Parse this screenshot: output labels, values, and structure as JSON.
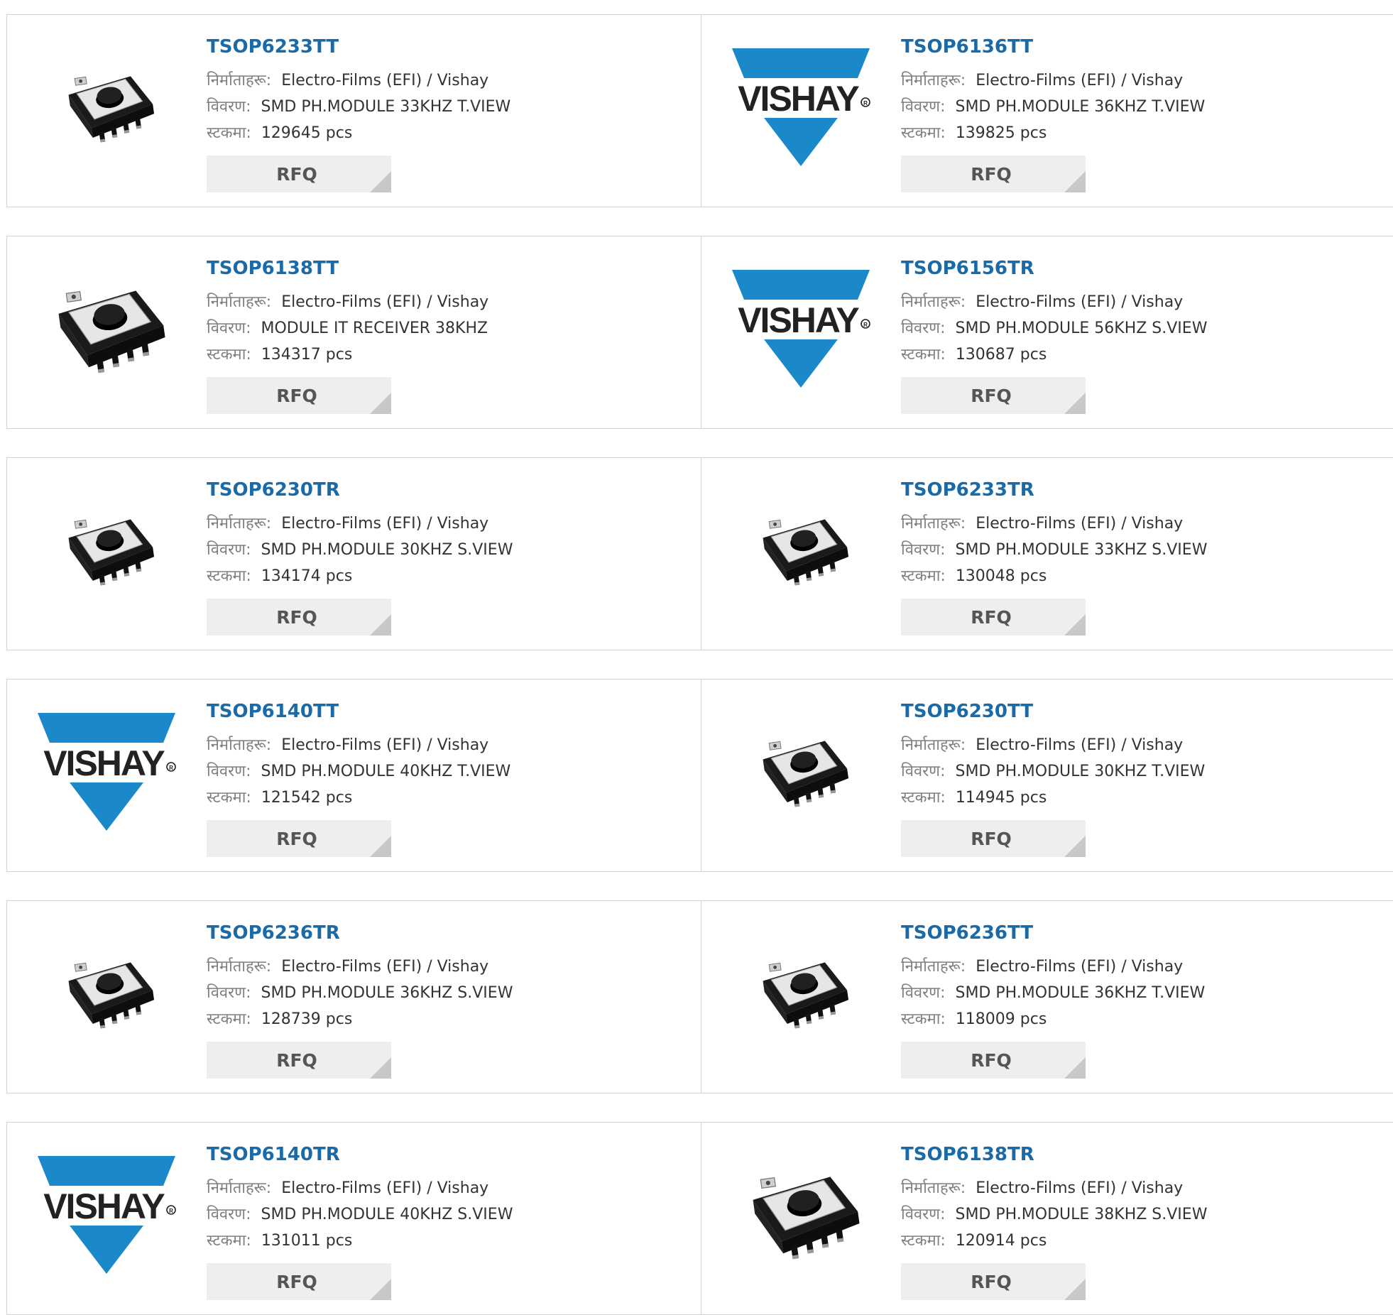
{
  "labels": {
    "manufacturer": "निर्माताहरू:",
    "description": "विवरण:",
    "stock": "स्टकमा:",
    "rfq": "RFQ"
  },
  "logo": {
    "text": "VISHAY",
    "registered": "®",
    "color": "#1b88c9"
  },
  "accent": "#1a6aa8",
  "products": [
    {
      "name": "TSOP6233TT",
      "manufacturer": "Electro-Films (EFI) / Vishay",
      "description": "SMD PH.MODULE 33KHZ T.VIEW",
      "stock": "129645 pcs",
      "image": "switch-small"
    },
    {
      "name": "TSOP6136TT",
      "manufacturer": "Electro-Films (EFI) / Vishay",
      "description": "SMD PH.MODULE 36KHZ T.VIEW",
      "stock": "139825 pcs",
      "image": "vishay-logo"
    },
    {
      "name": "TSOP6138TT",
      "manufacturer": "Electro-Films (EFI) / Vishay",
      "description": "MODULE IT RECEIVER 38KHZ",
      "stock": "134317 pcs",
      "image": "switch-large"
    },
    {
      "name": "TSOP6156TR",
      "manufacturer": "Electro-Films (EFI) / Vishay",
      "description": "SMD PH.MODULE 56KHZ S.VIEW",
      "stock": "130687 pcs",
      "image": "vishay-logo"
    },
    {
      "name": "TSOP6230TR",
      "manufacturer": "Electro-Films (EFI) / Vishay",
      "description": "SMD PH.MODULE 30KHZ S.VIEW",
      "stock": "134174 pcs",
      "image": "switch-small"
    },
    {
      "name": "TSOP6233TR",
      "manufacturer": "Electro-Films (EFI) / Vishay",
      "description": "SMD PH.MODULE 33KHZ S.VIEW",
      "stock": "130048 pcs",
      "image": "switch-small"
    },
    {
      "name": "TSOP6140TT",
      "manufacturer": "Electro-Films (EFI) / Vishay",
      "description": "SMD PH.MODULE 40KHZ T.VIEW",
      "stock": "121542 pcs",
      "image": "vishay-logo"
    },
    {
      "name": "TSOP6230TT",
      "manufacturer": "Electro-Films (EFI) / Vishay",
      "description": "SMD PH.MODULE 30KHZ T.VIEW",
      "stock": "114945 pcs",
      "image": "switch-small"
    },
    {
      "name": "TSOP6236TR",
      "manufacturer": "Electro-Films (EFI) / Vishay",
      "description": "SMD PH.MODULE 36KHZ S.VIEW",
      "stock": "128739 pcs",
      "image": "switch-small"
    },
    {
      "name": "TSOP6236TT",
      "manufacturer": "Electro-Films (EFI) / Vishay",
      "description": "SMD PH.MODULE 36KHZ T.VIEW",
      "stock": "118009 pcs",
      "image": "switch-small"
    },
    {
      "name": "TSOP6140TR",
      "manufacturer": "Electro-Films (EFI) / Vishay",
      "description": "SMD PH.MODULE 40KHZ S.VIEW",
      "stock": "131011 pcs",
      "image": "vishay-logo"
    },
    {
      "name": "TSOP6138TR",
      "manufacturer": "Electro-Films (EFI) / Vishay",
      "description": "SMD PH.MODULE 38KHZ S.VIEW",
      "stock": "120914 pcs",
      "image": "switch-large"
    }
  ]
}
